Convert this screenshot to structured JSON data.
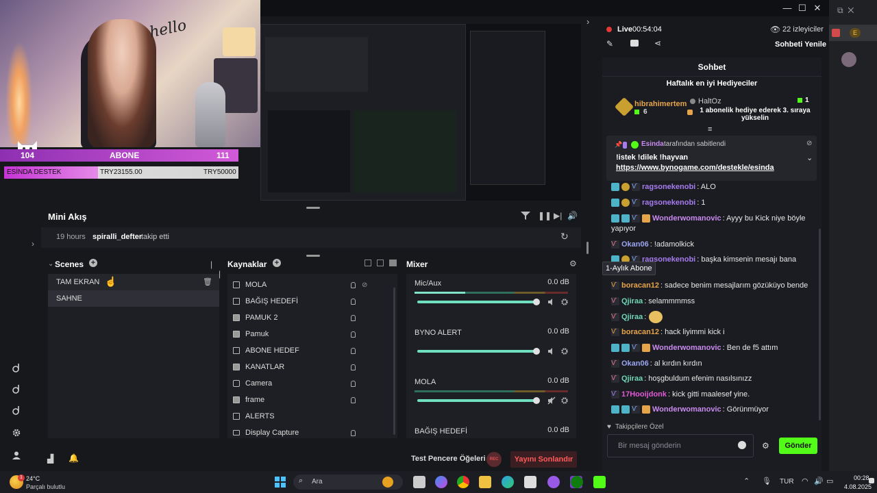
{
  "overlay": {
    "followers": "104",
    "abone_label": "ABONE",
    "abone_count": "111",
    "destek_label": "ESİNDA DESTEK",
    "destek_current": "TRY23155.00",
    "destek_goal": "TRY50000",
    "hello_text": "hello"
  },
  "mini_akis": {
    "title": "Mini Akış",
    "event_time": "19 hours",
    "event_user": "spiralli_defter",
    "event_action": "takip etti"
  },
  "scenes": {
    "title": "Scenes",
    "items": [
      "TAM EKRAN",
      "SAHNE"
    ]
  },
  "sources": {
    "title": "Kaynaklar",
    "items": [
      "MOLA",
      "BAĞIŞ HEDEFİ",
      "PAMUK 2",
      "Pamuk",
      "ABONE HEDEF",
      "KANATLAR",
      "Camera",
      "frame",
      "ALERTS",
      "Display Capture"
    ]
  },
  "mixer": {
    "title": "Mixer",
    "channels": [
      {
        "name": "Mic/Aux",
        "db": "0.0 dB"
      },
      {
        "name": "BYNO ALERT",
        "db": "0.0 dB"
      },
      {
        "name": "MOLA",
        "db": "0.0 dB"
      },
      {
        "name": "BAĞIŞ HEDEFİ",
        "db": "0.0 dB"
      }
    ]
  },
  "bottom": {
    "test_label": "Test Pencere Öğeleri",
    "rec_label": "REC",
    "end_stream": "Yayını Sonlandır"
  },
  "stream": {
    "live_label": "Live",
    "live_time": "00:54:04",
    "viewers": "22 izleyiciler",
    "refresh_chat": "Sohbeti Yenile"
  },
  "chat": {
    "title": "Sohbet",
    "top_gifters_title": "Haftalık en iyi Hediyeciler",
    "gifter1_name": "hibrahimertem",
    "gifter1_count": "6",
    "gifter2_name": "HaltOz",
    "gifter2_count": "1",
    "gift_cta": "1 abonelik hediye ederek 3. sıraya yükselin",
    "pinned_by_user": "Esinda",
    "pinned_by_suffix": "tarafından sabitlendi",
    "pinned_text": "!istek !dilek !hayvan",
    "pinned_link": "https://www.bynogame.com/destekle/esinda",
    "tooltip": "1-Aylık Abone",
    "messages": [
      {
        "user": "ragsonekenobi",
        "text": ": ALO",
        "color": "#a77cf0"
      },
      {
        "user": "ragsonekenobi",
        "text": ": 1",
        "color": "#a77cf0"
      },
      {
        "user": "Wonderwomanovic",
        "text": ": Ayyy bu Kick niye böyle",
        "color": "#c98bf0"
      },
      {
        "user": "",
        "text": "yapıyor",
        "color": "#c98bf0"
      },
      {
        "user": "Okan06",
        "text": ": !adamolkick",
        "color": "#9aa4f0"
      },
      {
        "user": "ragsonekenobi",
        "text": ": başka kimsenin mesajı bana",
        "color": "#a77cf0"
      },
      {
        "user": "boracan12",
        "text": ": sadece benim mesajlarım gözüküyo bende",
        "color": "#e6a44a"
      },
      {
        "user": "Qjiraa",
        "text": ": selammmmss",
        "color": "#6fd6b4"
      },
      {
        "user": "Qjiraa",
        "text": ":",
        "color": "#6fd6b4"
      },
      {
        "user": "boracan12",
        "text": ": hack liyimmi kick i",
        "color": "#e6a44a"
      },
      {
        "user": "Wonderwomanovic",
        "text": ": Ben de f5 attım",
        "color": "#c98bf0"
      },
      {
        "user": "Okan06",
        "text": ": al kırdın kırdın",
        "color": "#9aa4f0"
      },
      {
        "user": "Qjiraa",
        "text": ": hoşgbuldum efenim nasılsınızz",
        "color": "#6fd6b4"
      },
      {
        "user": "17Hooijdonk",
        "text": ": kick gitti maalesef yine.",
        "color": "#e05ad8"
      },
      {
        "user": "Wonderwomanovic",
        "text": ": Görünmüyor",
        "color": "#c98bf0"
      }
    ],
    "followers_only": "Takipçilere Özel",
    "input_placeholder": "Bir mesaj gönderin",
    "send_label": "Gönder"
  },
  "taskbar": {
    "weather_temp": "24°C",
    "weather_desc": "Parçalı bulutlu",
    "weather_badge": "1",
    "search_label": "Ara",
    "lang": "TUR",
    "time": "00:28",
    "date": "4.08.2025"
  },
  "browser": {
    "ext_letter": "E"
  },
  "colors": {
    "accent_green": "#53fc18",
    "live_red": "#e53935",
    "end_stream_red": "#ff5a5a"
  }
}
